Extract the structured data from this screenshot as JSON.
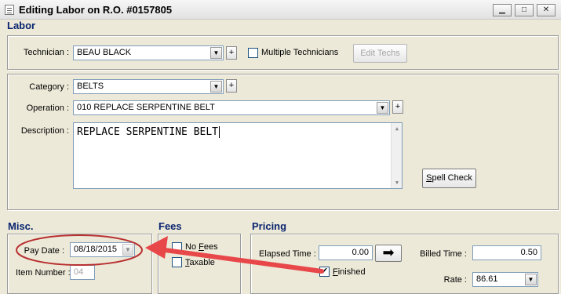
{
  "window": {
    "title": "Editing Labor on R.O. #0157805"
  },
  "sections": {
    "labor": "Labor",
    "misc": "Misc.",
    "fees": "Fees",
    "pricing": "Pricing"
  },
  "technician": {
    "label": "Technician :",
    "value": "BEAU BLACK",
    "plus": "+",
    "multiple_label": "Multiple Technicians",
    "edit_techs": "Edit Techs"
  },
  "category": {
    "label": "Category :",
    "value": "BELTS",
    "plus": "+"
  },
  "operation": {
    "label": "Operation :",
    "value": "010  REPLACE SERPENTINE BELT",
    "plus": "+"
  },
  "description": {
    "label": "Description :",
    "value": "REPLACE SERPENTINE BELT"
  },
  "spell_check": "Spell Check",
  "misc": {
    "pay_date_label": "Pay Date :",
    "pay_date": "08/18/2015",
    "item_number_label": "Item Number :",
    "item_number": "04"
  },
  "fees": {
    "no_fees": "No Fees",
    "taxable": "Taxable"
  },
  "pricing": {
    "elapsed_label": "Elapsed Time :",
    "elapsed": "0.00",
    "billed_label": "Billed Time :",
    "billed": "0.50",
    "finished_label": "Finished",
    "finished_checked": "✔",
    "rate_label": "Rate :",
    "rate": "86.61"
  },
  "colors": {
    "heading": "#0a2470",
    "annotation": "#e8474a",
    "highlight_oval": "#b83030"
  }
}
